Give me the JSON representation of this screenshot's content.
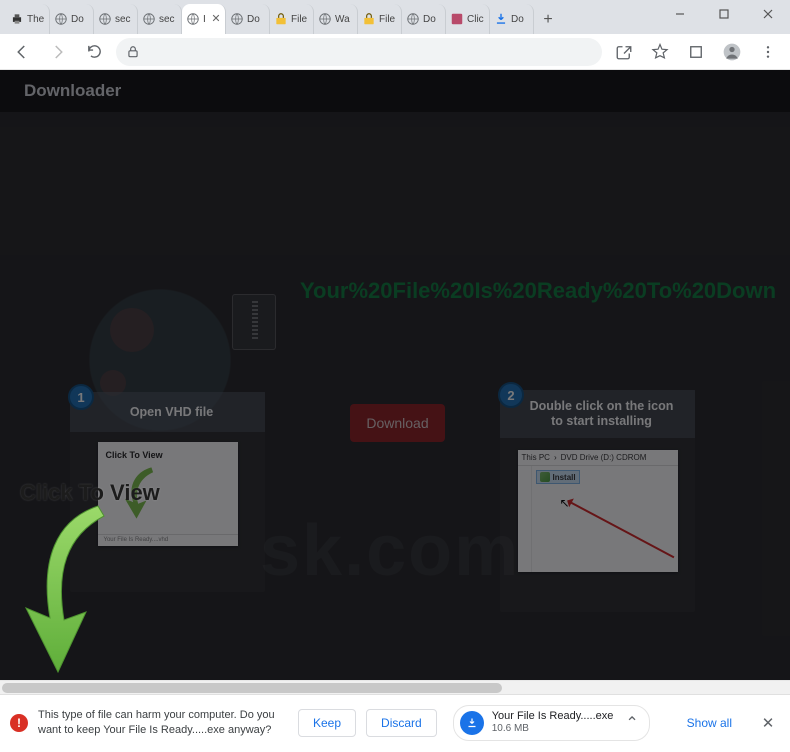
{
  "tabs": [
    {
      "title": "The",
      "icon": "printer"
    },
    {
      "title": "Do",
      "icon": "globe"
    },
    {
      "title": "sec",
      "icon": "globe"
    },
    {
      "title": "sec",
      "icon": "globe"
    },
    {
      "title": "I",
      "icon": "globe",
      "active": true
    },
    {
      "title": "Do",
      "icon": "globe"
    },
    {
      "title": "File",
      "icon": "lock-y"
    },
    {
      "title": "Wa",
      "icon": "globe"
    },
    {
      "title": "File",
      "icon": "lock-y"
    },
    {
      "title": "Do",
      "icon": "globe"
    },
    {
      "title": "Clic",
      "icon": "app"
    },
    {
      "title": "Do",
      "icon": "dl"
    }
  ],
  "page": {
    "header": "Downloader",
    "readyText": "Your%20File%20Is%20Ready%20To%20Down",
    "downloadBtn": "Download",
    "step1": {
      "badge": "1",
      "title": "Open VHD file",
      "cardLabel": "Click To View",
      "cardFooter": "Your File Is Ready....vhd"
    },
    "step2": {
      "badge": "2",
      "title": "Double click on the icon to start installing",
      "crumb1": "This PC",
      "crumb2": "DVD Drive (D:) CDROM",
      "item": "Install"
    },
    "overlayLabel": "Click To View"
  },
  "dlbar": {
    "warning": "This type of file can harm your computer. Do you want to keep Your File Is Ready.....exe anyway?",
    "keep": "Keep",
    "discard": "Discard",
    "filename": "Your File Is Ready.....exe",
    "size": "10.6 MB",
    "showAll": "Show all"
  }
}
